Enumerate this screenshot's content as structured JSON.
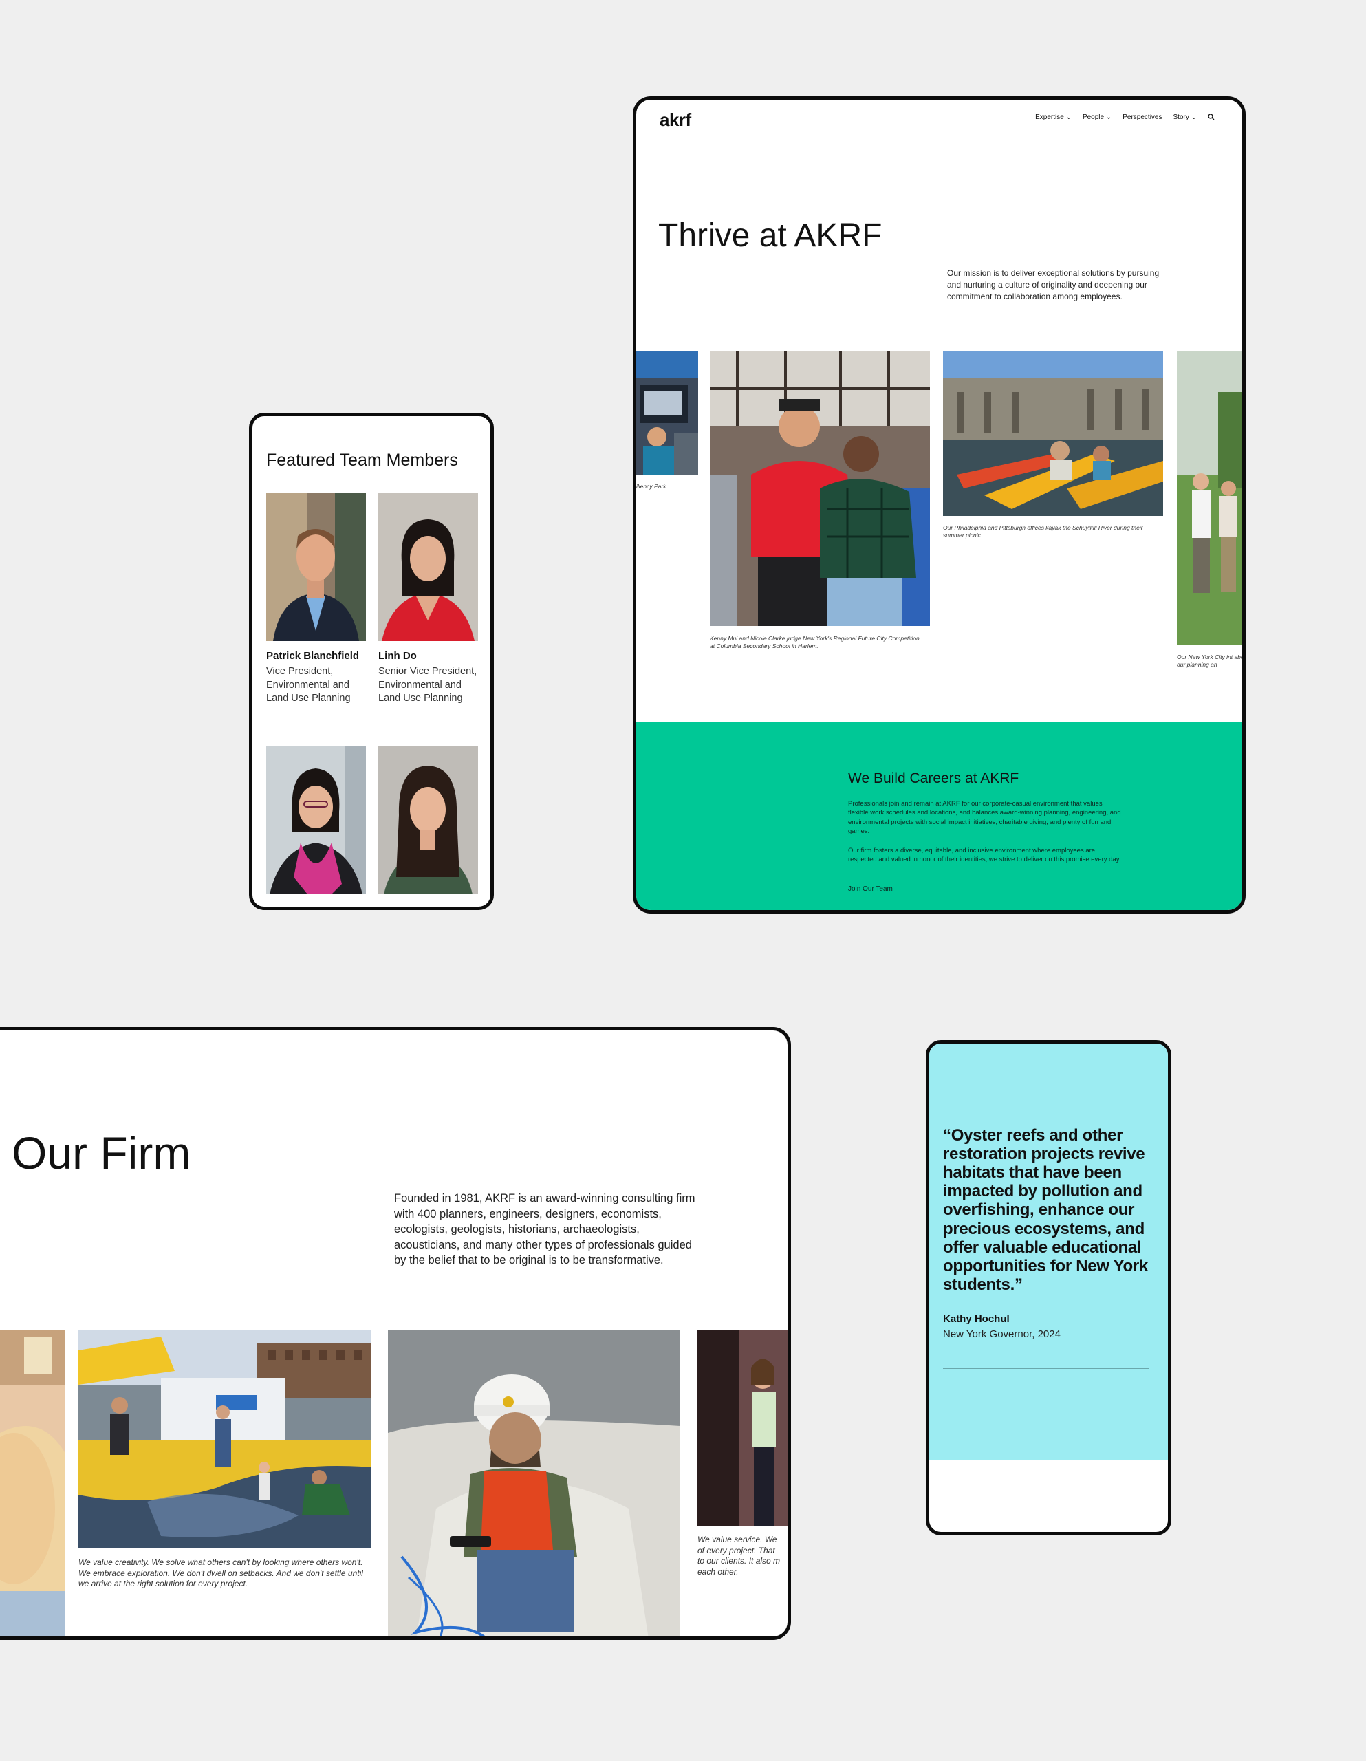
{
  "tablet": {
    "logo": "akrf",
    "nav": [
      "Expertise ⌄",
      "People ⌄",
      "Perspectives",
      "Story ⌄"
    ],
    "hero_title": "Thrive at AKRF",
    "mission": "Our mission is to deliver exceptional solutions by pursuing and nurturing a culture of originality and deepening our commitment to collaboration among employees.",
    "captions": {
      "left_partial": "iliency Park",
      "center": "Kenny Mui and Nicole Clarke judge New York's Regional Future City Competition at Columbia Secondary School in Harlem.",
      "kayak": "Our Philadelphia and Pittsburgh offices kayak the Schuylkill River during their summer picnic.",
      "right_partial": "Our New York City int about our planning an"
    },
    "careers": {
      "heading": "We Build Careers at AKRF",
      "p1": "Professionals join and remain at AKRF for our corporate-casual environment that values flexible work schedules and locations, and balances award-winning planning, engineering, and environmental projects with social impact initiatives, charitable giving, and plenty of fun and games.",
      "p2": "Our firm fosters a diverse, equitable, and inclusive environment where employees are respected and valued in honor of their identities; we strive to deliver on this promise every day.",
      "link": "Join Our Team"
    },
    "accent": "#00c896"
  },
  "team": {
    "heading": "Featured Team Members",
    "members": [
      {
        "name": "Patrick Blanchfield",
        "role": "Vice President, Environmental and Land Use Planning"
      },
      {
        "name": "Linh Do",
        "role": "Senior Vice President, Environmental and Land Use Planning"
      }
    ]
  },
  "firm": {
    "title": "Our Firm",
    "founded": "Founded in 1981, AKRF is an award-winning consulting firm with 400 planners, engineers, designers, economists, ecologists, geologists, historians, archaeologists, acousticians, and many other types of professionals guided by the belief that to be original is to be transformative.",
    "captions": {
      "creativity": "We value creativity. We solve what others can't by looking where others won't. We embrace exploration. We don't dwell on setbacks. And we don't settle until we arrive at the right solution for every project.",
      "service_partial": "We value service. We of every project. That to our clients. It also m each other."
    }
  },
  "quote": {
    "text": "“Oyster reefs and other restoration projects revive habitats that have been impacted by pollution and overfishing, enhance our precious ecosystems, and offer valuable educational opportunities for New York students.”",
    "author": "Kathy Hochul",
    "author_title": "New York Governor, 2024",
    "accent": "#9cecf2"
  },
  "icons": {
    "search": "search-icon"
  }
}
